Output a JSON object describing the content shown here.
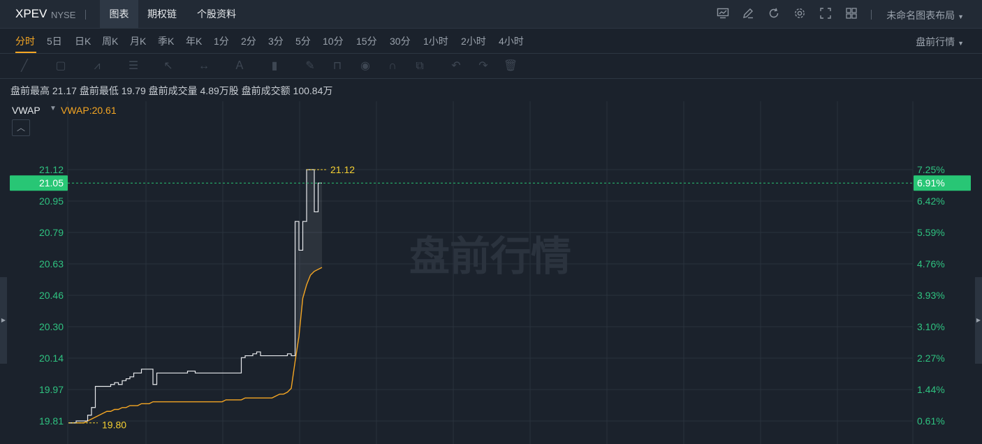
{
  "header": {
    "symbol": "XPEV",
    "exchange": "NYSE",
    "tabs": [
      {
        "label": "图表",
        "active": true
      },
      {
        "label": "期权链",
        "active": false
      },
      {
        "label": "个股资料",
        "active": false
      }
    ],
    "icons": [
      "indicator-icon",
      "draw-icon",
      "refresh-icon",
      "settings-icon",
      "fullscreen-icon",
      "grid-layout-icon"
    ],
    "layout_label": "未命名图表布局"
  },
  "periods": {
    "items": [
      "分时",
      "5日",
      "日K",
      "周K",
      "月K",
      "季K",
      "年K",
      "1分",
      "2分",
      "3分",
      "5分",
      "10分",
      "15分",
      "30分",
      "1小时",
      "2小时",
      "4小时"
    ],
    "active": "分时",
    "session_label": "盘前行情"
  },
  "toolbar_icons": [
    "trend-line-icon",
    "rectangle-icon",
    "pattern-icon",
    "fibonacci-icon",
    "arrow-icon",
    "measure-icon",
    "text-icon",
    "bars-icon",
    "brush-icon",
    "lock-icon",
    "eye-icon",
    "magnet-icon",
    "layers-icon",
    "undo-icon",
    "redo-icon",
    "trash-icon"
  ],
  "stats": {
    "text": "盘前最高 21.17 盘前最低 19.79 盘前成交量 4.89万股 盘前成交额 100.84万"
  },
  "indicator": {
    "name": "VWAP",
    "value": "VWAP:20.61"
  },
  "colors": {
    "background": "#1b222c",
    "grid": "#2a323d",
    "price_line": "#e8eaed",
    "vwap_line": "#f5a623",
    "label_green": "#2fc280",
    "current_badge": "#28c675",
    "marker_yellow": "#f5d033"
  },
  "chart_data": {
    "type": "line",
    "watermark": "盘前行情",
    "y_ticks": [
      "21.12",
      "20.95",
      "20.79",
      "20.63",
      "20.46",
      "20.30",
      "20.14",
      "19.97",
      "19.81"
    ],
    "pct_ticks": [
      "7.25%",
      "6.42%",
      "5.59%",
      "4.76%",
      "3.93%",
      "3.10%",
      "2.27%",
      "1.44%",
      "0.61%"
    ],
    "ylim": [
      19.81,
      21.12
    ],
    "current_price": "21.05",
    "current_pct": "6.91%",
    "high_marker": "21.12",
    "low_marker": "19.80",
    "price_series": [
      19.8,
      19.8,
      19.81,
      19.81,
      19.81,
      19.84,
      19.88,
      19.99,
      19.99,
      19.99,
      19.99,
      20.0,
      20.01,
      20.0,
      20.02,
      20.03,
      20.04,
      20.06,
      20.06,
      20.08,
      20.08,
      20.08,
      20.0,
      20.06,
      20.06,
      20.06,
      20.06,
      20.06,
      20.06,
      20.06,
      20.06,
      20.07,
      20.07,
      20.06,
      20.06,
      20.06,
      20.06,
      20.06,
      20.06,
      20.06,
      20.06,
      20.06,
      20.06,
      20.06,
      20.06,
      20.14,
      20.15,
      20.15,
      20.16,
      20.17,
      20.15,
      20.15,
      20.15,
      20.15,
      20.15,
      20.15,
      20.15,
      20.16,
      20.15,
      20.85,
      20.7,
      20.85,
      21.12,
      21.12,
      20.9,
      21.05,
      21.05
    ],
    "vwap_series": [
      19.8,
      19.8,
      19.8,
      19.8,
      19.8,
      19.81,
      19.82,
      19.83,
      19.84,
      19.85,
      19.86,
      19.86,
      19.87,
      19.87,
      19.88,
      19.88,
      19.89,
      19.89,
      19.89,
      19.9,
      19.9,
      19.9,
      19.91,
      19.91,
      19.91,
      19.91,
      19.91,
      19.91,
      19.91,
      19.91,
      19.91,
      19.91,
      19.91,
      19.91,
      19.91,
      19.91,
      19.91,
      19.91,
      19.91,
      19.91,
      19.91,
      19.92,
      19.92,
      19.92,
      19.92,
      19.92,
      19.93,
      19.93,
      19.93,
      19.93,
      19.93,
      19.93,
      19.93,
      19.93,
      19.94,
      19.95,
      19.95,
      19.96,
      19.98,
      20.12,
      20.25,
      20.45,
      20.52,
      20.57,
      20.59,
      20.6,
      20.61
    ]
  }
}
